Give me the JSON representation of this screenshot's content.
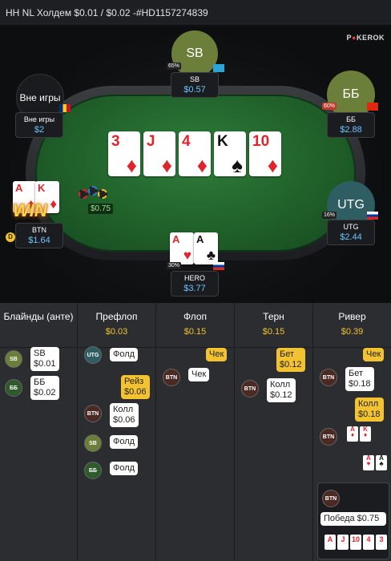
{
  "header": {
    "title": "HH NL Холдем $0.01 / $0.02 -#HD1157274839"
  },
  "brand": {
    "logo_left": "P",
    "logo_right": "KEROK"
  },
  "seats": {
    "sb": {
      "avatar": "SB",
      "name": "SB",
      "stack": "$0.57",
      "pct": "65%",
      "color": "#6b7f3a",
      "flag": "KZ"
    },
    "bb": {
      "avatar": "ББ",
      "name": "ББ",
      "stack": "$2.88",
      "pct": "60%",
      "color": "#6b7f3a",
      "flag": "HK"
    },
    "utg": {
      "avatar": "UTG",
      "name": "UTG",
      "stack": "$2.44",
      "pct": "16%",
      "color": "#2f5e62",
      "flag": "RU"
    },
    "hero": {
      "name": "HERO",
      "stack": "$3.77",
      "pct": "30%",
      "flag": "RU"
    },
    "btn": {
      "name": "BTN",
      "stack": "$1.64",
      "win": "WIN",
      "chips": "$0.75"
    },
    "out": {
      "status": "Вне игры",
      "name": "Вне игры",
      "stack": "$2",
      "flag": "RO"
    }
  },
  "board": [
    {
      "rank": "3",
      "suit": "♦",
      "red": true
    },
    {
      "rank": "J",
      "suit": "♦",
      "red": true
    },
    {
      "rank": "4",
      "suit": "♦",
      "red": true
    },
    {
      "rank": "K",
      "suit": "♠",
      "red": false
    },
    {
      "rank": "10",
      "suit": "♦",
      "red": true
    }
  ],
  "hero_cards": [
    {
      "rank": "A",
      "suit": "♥",
      "red": true
    },
    {
      "rank": "A",
      "suit": "♣",
      "red": false
    }
  ],
  "btn_cards": [
    {
      "rank": "A",
      "suit": "♦",
      "red": true
    },
    {
      "rank": "K",
      "suit": "♦",
      "red": true
    }
  ],
  "history": {
    "columns": [
      {
        "name": "Блайнды (анте)",
        "pot": ""
      },
      {
        "name": "Префлоп",
        "pot": "$0.03"
      },
      {
        "name": "Флоп",
        "pot": "$0.15"
      },
      {
        "name": "Терн",
        "pot": "$0.15"
      },
      {
        "name": "Ривер",
        "pot": "$0.39"
      }
    ],
    "blinds": [
      {
        "pos": "SB",
        "action": "SB",
        "amount": "$0.01"
      },
      {
        "pos": "ББ",
        "action": "ББ",
        "amount": "$0.02"
      }
    ],
    "preflop": [
      {
        "pos": "UTG",
        "action": "Фолд"
      },
      {
        "action": "Рейз",
        "amount": "$0.06"
      },
      {
        "pos": "BTN",
        "action": "Колл",
        "amount": "$0.06"
      },
      {
        "pos": "SB",
        "action": "Фолд"
      },
      {
        "pos": "ББ",
        "action": "Фолд"
      }
    ],
    "flop": [
      {
        "action": "Чек"
      },
      {
        "pos": "BTN",
        "action": "Чек"
      }
    ],
    "turn": [
      {
        "action": "Бет",
        "amount": "$0.12"
      },
      {
        "pos": "BTN",
        "action": "Колл",
        "amount": "$0.12"
      }
    ],
    "river": [
      {
        "action": "Чек"
      },
      {
        "pos": "BTN",
        "action": "Бет",
        "amount": "$0.18"
      },
      {
        "action": "Колл",
        "amount": "$0.18"
      },
      {
        "pos": "BTN"
      },
      {
        "pos": "BTN",
        "result": "Победа $0.75"
      }
    ],
    "win_cards": [
      "A",
      "J",
      "10",
      "4",
      "3"
    ]
  },
  "colors": {
    "accent": "#f2c230",
    "stack": "#6cc3ff",
    "felt": "#2e7d3a"
  }
}
